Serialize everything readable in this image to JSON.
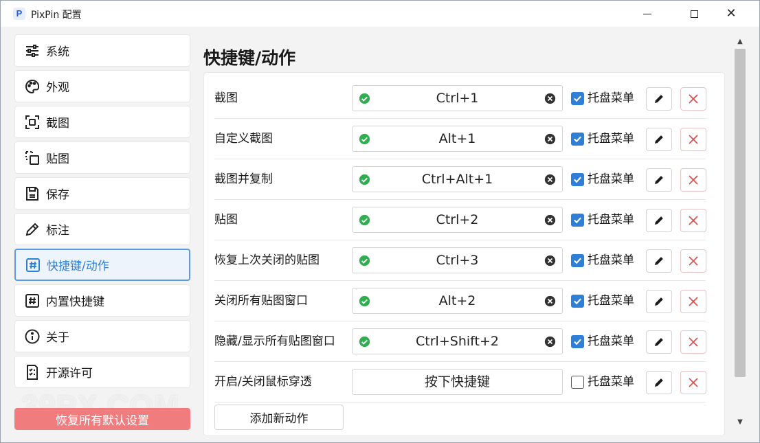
{
  "window": {
    "title": "PixPin 配置",
    "app_icon_letter": "P",
    "close_glyph": "✕"
  },
  "sidebar": {
    "items": [
      {
        "label": "系统",
        "icon": "sliders-icon"
      },
      {
        "label": "外观",
        "icon": "palette-icon"
      },
      {
        "label": "截图",
        "icon": "screenshot-icon"
      },
      {
        "label": "贴图",
        "icon": "pin-icon"
      },
      {
        "label": "保存",
        "icon": "save-icon"
      },
      {
        "label": "标注",
        "icon": "pencil-icon"
      },
      {
        "label": "快捷键/动作",
        "icon": "hash-icon",
        "active": true
      },
      {
        "label": "内置快捷键",
        "icon": "hash-icon"
      },
      {
        "label": "关于",
        "icon": "info-icon"
      },
      {
        "label": "开源许可",
        "icon": "checklist-icon"
      }
    ],
    "reset_label": "恢复所有默认设置",
    "watermark": "39PX.COM"
  },
  "main": {
    "title": "快捷键/动作",
    "tray_label": "托盘菜单",
    "rows": [
      {
        "label": "截图",
        "hotkey": "Ctrl+1",
        "set": true,
        "tray": true
      },
      {
        "label": "自定义截图",
        "hotkey": "Alt+1",
        "set": true,
        "tray": true
      },
      {
        "label": "截图并复制",
        "hotkey": "Ctrl+Alt+1",
        "set": true,
        "tray": true
      },
      {
        "label": "贴图",
        "hotkey": "Ctrl+2",
        "set": true,
        "tray": true
      },
      {
        "label": "恢复上次关闭的贴图",
        "hotkey": "Ctrl+3",
        "set": true,
        "tray": true
      },
      {
        "label": "关闭所有贴图窗口",
        "hotkey": "Alt+2",
        "set": true,
        "tray": true
      },
      {
        "label": "隐藏/显示所有贴图窗口",
        "hotkey": "Ctrl+Shift+2",
        "set": true,
        "tray": true
      },
      {
        "label": "开启/关闭鼠标穿透",
        "hotkey": "按下快捷键",
        "set": false,
        "tray": false
      }
    ],
    "add_label": "添加新动作"
  },
  "colors": {
    "accent": "#2f7fd6",
    "ok_green": "#2fae4f",
    "delete_red": "#e04848",
    "reset_bg": "#f07c7e"
  }
}
